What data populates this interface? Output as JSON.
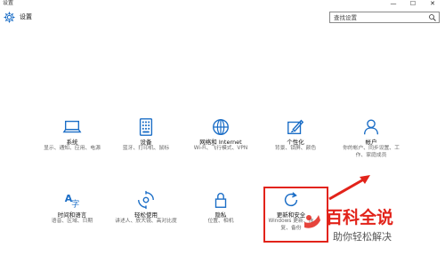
{
  "window": {
    "title": "设置",
    "controls": {
      "minimize": "—",
      "maximize": "☐",
      "close": "✕"
    }
  },
  "header": {
    "title": "设置"
  },
  "search": {
    "placeholder": "查找设置"
  },
  "tiles": [
    {
      "id": "system",
      "title": "系统",
      "desc": "显示、通知、应用、电源",
      "icon": "laptop-icon"
    },
    {
      "id": "devices",
      "title": "设备",
      "desc": "蓝牙、打印机、鼠标",
      "icon": "keyboard-icon"
    },
    {
      "id": "network",
      "title": "网络和 Internet",
      "desc": "Wi-Fi、飞行模式、VPN",
      "icon": "globe-icon"
    },
    {
      "id": "personalization",
      "title": "个性化",
      "desc": "背景、锁屏、颜色",
      "icon": "paint-icon"
    },
    {
      "id": "accounts",
      "title": "帐户",
      "desc": "你的帐户、同步设置、工作、家庭成员",
      "icon": "person-icon"
    },
    {
      "id": "time-language",
      "title": "时间和语言",
      "desc": "语音、区域、日期",
      "icon": "time-language-icon"
    },
    {
      "id": "ease-of-access",
      "title": "轻松使用",
      "desc": "讲述人、放大镜、高对比度",
      "icon": "ease-icon"
    },
    {
      "id": "privacy",
      "title": "隐私",
      "desc": "位置、相机",
      "icon": "lock-icon"
    },
    {
      "id": "update-security",
      "title": "更新和安全",
      "desc": "Windows 更新、恢复、备份",
      "icon": "refresh-icon"
    }
  ],
  "watermark": {
    "main": "百科全说",
    "sub": "助你轻松解决"
  },
  "colors": {
    "accent": "#1a6dc6",
    "highlight": "#e2231a"
  }
}
